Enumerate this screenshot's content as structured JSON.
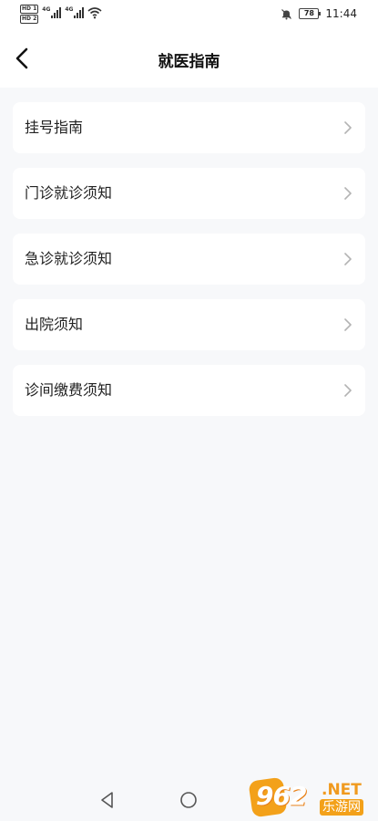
{
  "status_bar": {
    "hd1": "HD 1",
    "hd2": "HD 2",
    "net1": "4G",
    "net2": "4G",
    "battery": "78",
    "time": "11:44"
  },
  "header": {
    "title": "就医指南"
  },
  "menu": {
    "items": [
      {
        "label": "挂号指南"
      },
      {
        "label": "门诊就诊须知"
      },
      {
        "label": "急诊就诊须知"
      },
      {
        "label": "出院须知"
      },
      {
        "label": "诊间缴费须知"
      }
    ]
  },
  "watermark": {
    "number": "962",
    "suffix": ".NET",
    "caption": "乐游网"
  },
  "icons": {
    "back": "chevron-left-icon",
    "item_arrow": "chevron-right-icon",
    "nav_back": "triangle-back-icon",
    "nav_home": "circle-home-icon"
  },
  "colors": {
    "background": "#f7f8fa",
    "card": "#ffffff",
    "chevron": "#b3b3b3",
    "watermark": "#f3a11a"
  }
}
